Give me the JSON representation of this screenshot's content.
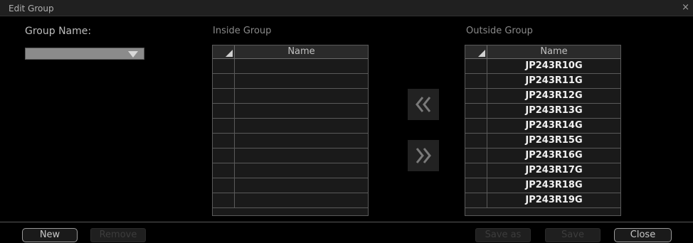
{
  "window": {
    "title": "Edit Group",
    "close_glyph": "×"
  },
  "form": {
    "group_name_label": "Group Name:",
    "group_name_value": "",
    "inside_label": "Inside Group",
    "outside_label": "Outside Group"
  },
  "inside_grid": {
    "header": "Name",
    "rows": [
      "",
      "",
      "",
      "",
      "",
      "",
      "",
      "",
      "",
      ""
    ]
  },
  "outside_grid": {
    "header": "Name",
    "rows": [
      "JP243R10G",
      "JP243R11G",
      "JP243R12G",
      "JP243R13G",
      "JP243R14G",
      "JP243R15G",
      "JP243R16G",
      "JP243R17G",
      "JP243R18G",
      "JP243R19G"
    ]
  },
  "buttons": {
    "move_left_icon": "double-chevron-left-icon",
    "move_right_icon": "double-chevron-right-icon",
    "new": "New",
    "remove": "Remove",
    "save_as": "Save as",
    "save": "Save",
    "close": "Close"
  },
  "colors": {
    "row_text": "#f2f2f2",
    "dropdown": "#8b8b8b",
    "move_button": "#222222"
  }
}
